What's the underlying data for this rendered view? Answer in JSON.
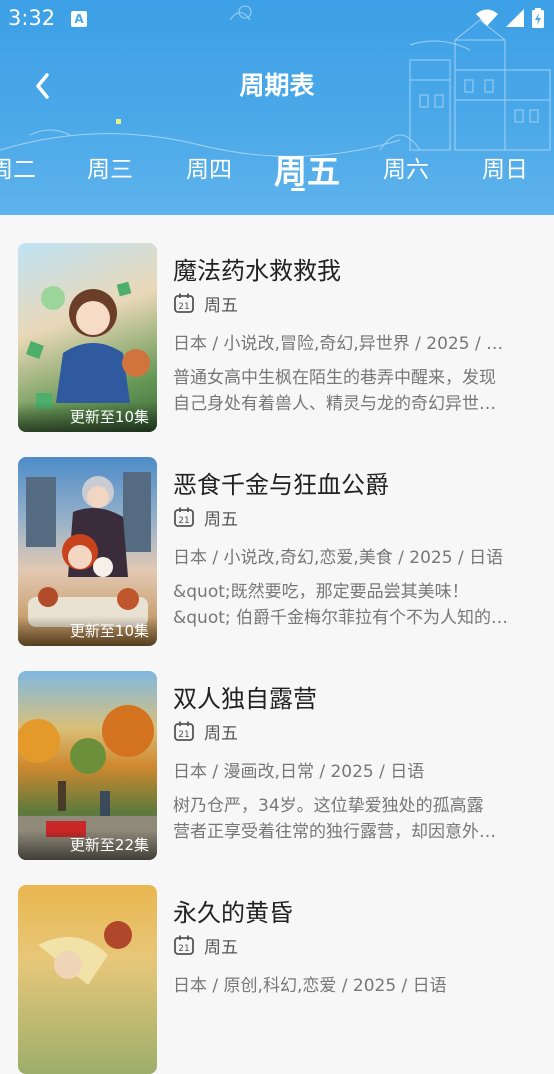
{
  "status_bar": {
    "time": "3:32",
    "notification_icon": "A"
  },
  "header": {
    "title": "周期表",
    "back_icon": "chevron-left-icon"
  },
  "tabs": [
    {
      "label": "周二",
      "active": false
    },
    {
      "label": "周三",
      "active": false
    },
    {
      "label": "周四",
      "active": false
    },
    {
      "label": "周五",
      "active": true
    },
    {
      "label": "周六",
      "active": false
    },
    {
      "label": "周日",
      "active": false
    }
  ],
  "items": [
    {
      "title": "魔法药水救救我",
      "weekday": "周五",
      "meta": "日本 / 小说改,冒险,奇幻,异世界 / 2025 / …",
      "desc_line1": "普通女高中生枫在陌生的巷弄中醒来，发现",
      "desc_line2": "自己身处有着兽人、精灵与龙的奇幻异世…",
      "badge": "更新至10集"
    },
    {
      "title": "恶食千金与狂血公爵",
      "weekday": "周五",
      "meta": "日本 / 小说改,奇幻,恋爱,美食 / 2025 / 日语",
      "desc_line1": "&quot;既然要吃，那定要品尝其美味！",
      "desc_line2": "&quot; 伯爵千金梅尔菲拉有个不为人知的…",
      "badge": "更新至10集"
    },
    {
      "title": "双人独自露营",
      "weekday": "周五",
      "meta": "日本 / 漫画改,日常 / 2025 / 日语",
      "desc_line1": "树乃仓严，34岁。这位挚爱独处的孤高露",
      "desc_line2": "营者正享受着往常的独行露营，却因意外…",
      "badge": "更新至22集"
    },
    {
      "title": "永久的黄昏",
      "weekday": "周五",
      "meta": "日本 / 原创,科幻,恋爱 / 2025 / 日语",
      "desc_line1": "",
      "desc_line2": "",
      "badge": ""
    }
  ]
}
